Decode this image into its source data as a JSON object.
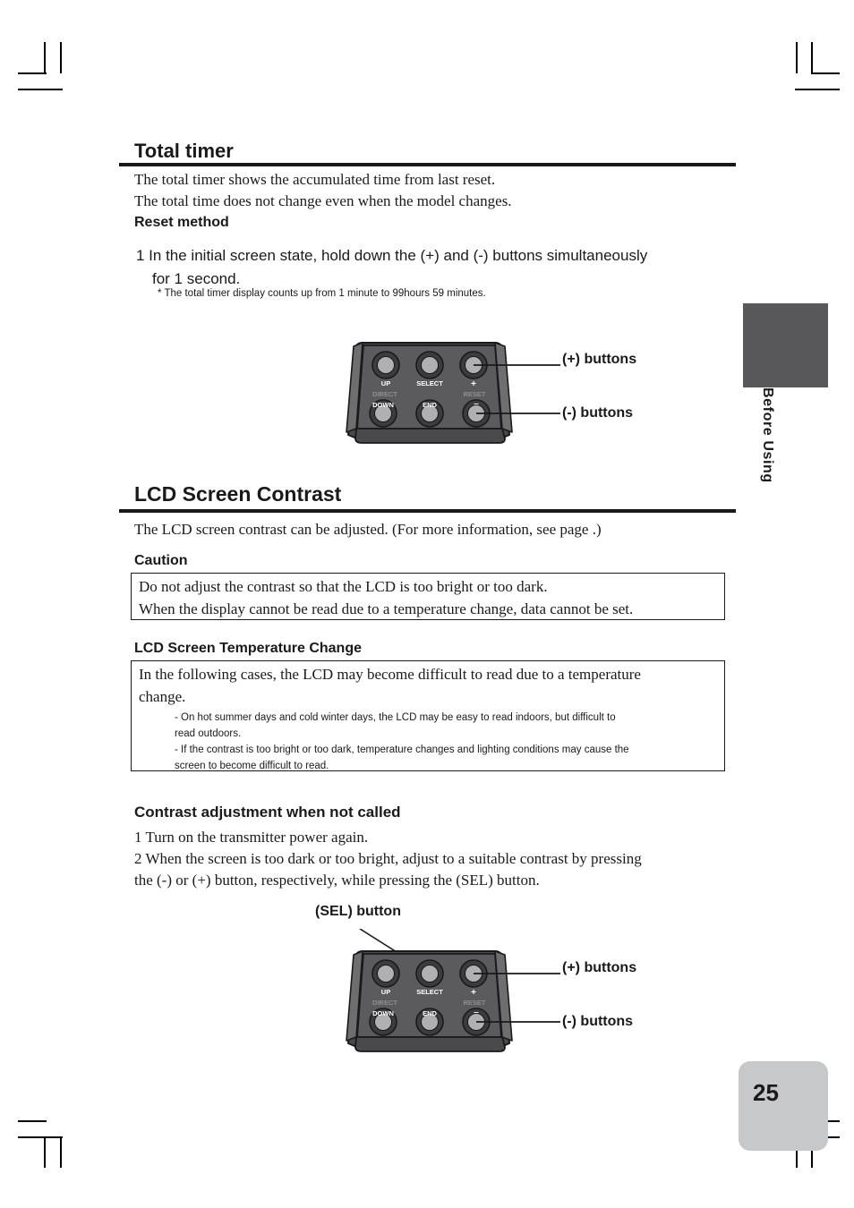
{
  "page": {
    "number": "25",
    "side_tab": "Before Using"
  },
  "sections": {
    "total_timer": {
      "title": "Total timer",
      "intro_line1": "The total timer shows the accumulated time from last reset.",
      "intro_line2": "The total time does not change even when the model changes.",
      "reset_method_heading": "Reset method",
      "step1_line1": "1 In the initial screen state, hold down the (+) and (-) buttons simultaneously",
      "step1_line2": "for 1 second.",
      "footnote": "* The total timer display counts up from 1 minute to 99hours 59 minutes."
    },
    "lcd_contrast": {
      "title": "LCD Screen Contrast",
      "intro": "The LCD screen contrast can be adjusted. (For more information, see page   .)",
      "caution_heading": "Caution",
      "caution_line1": "Do not adjust the contrast so that the LCD is too bright or too dark.",
      "caution_line2": "When the display cannot be read due to a temperature change, data cannot be set.",
      "temp_change_heading": "LCD Screen Temperature Change",
      "temp_line1": "In the following cases, the LCD may become difficult to read due to a temperature",
      "temp_line2": "change.",
      "temp_note1": "- On hot summer days and cold winter days, the LCD may be easy to read indoors, but difficult to",
      "temp_note1b": "read outdoors.",
      "temp_note2": "- If the contrast is too bright or too dark, temperature changes and lighting conditions may cause the",
      "temp_note2b": "screen to become difficult to read.",
      "adjust_heading": "Contrast adjustment when not called",
      "adjust_step1": "1 Turn on the transmitter power again.",
      "adjust_step2_line1": "2 When the screen is too dark or too bright, adjust to a suitable contrast by pressing",
      "adjust_step2_line2": "the (-) or (+) button, respectively, while pressing the (SEL) button."
    }
  },
  "keypad": {
    "buttons": {
      "up": "UP",
      "select": "SELECT",
      "plus": "+",
      "direct": "DIRECT",
      "reset": "RESET",
      "down": "DOWN",
      "end": "END",
      "minus": "–"
    },
    "callouts": {
      "plus_buttons": "(+)  buttons",
      "minus_buttons": "(-) buttons",
      "sel_button": "(SEL) button"
    },
    "colors": {
      "body": "#5b5b5d",
      "body_dark": "#4a4a4c",
      "body_light": "#6e6e70",
      "button_face": "#b0b0b2",
      "button_ring": "#3c3c3e",
      "label_light": "#ffffff",
      "label_dim": "#8e8e90",
      "outline": "#1a1a1a"
    }
  }
}
